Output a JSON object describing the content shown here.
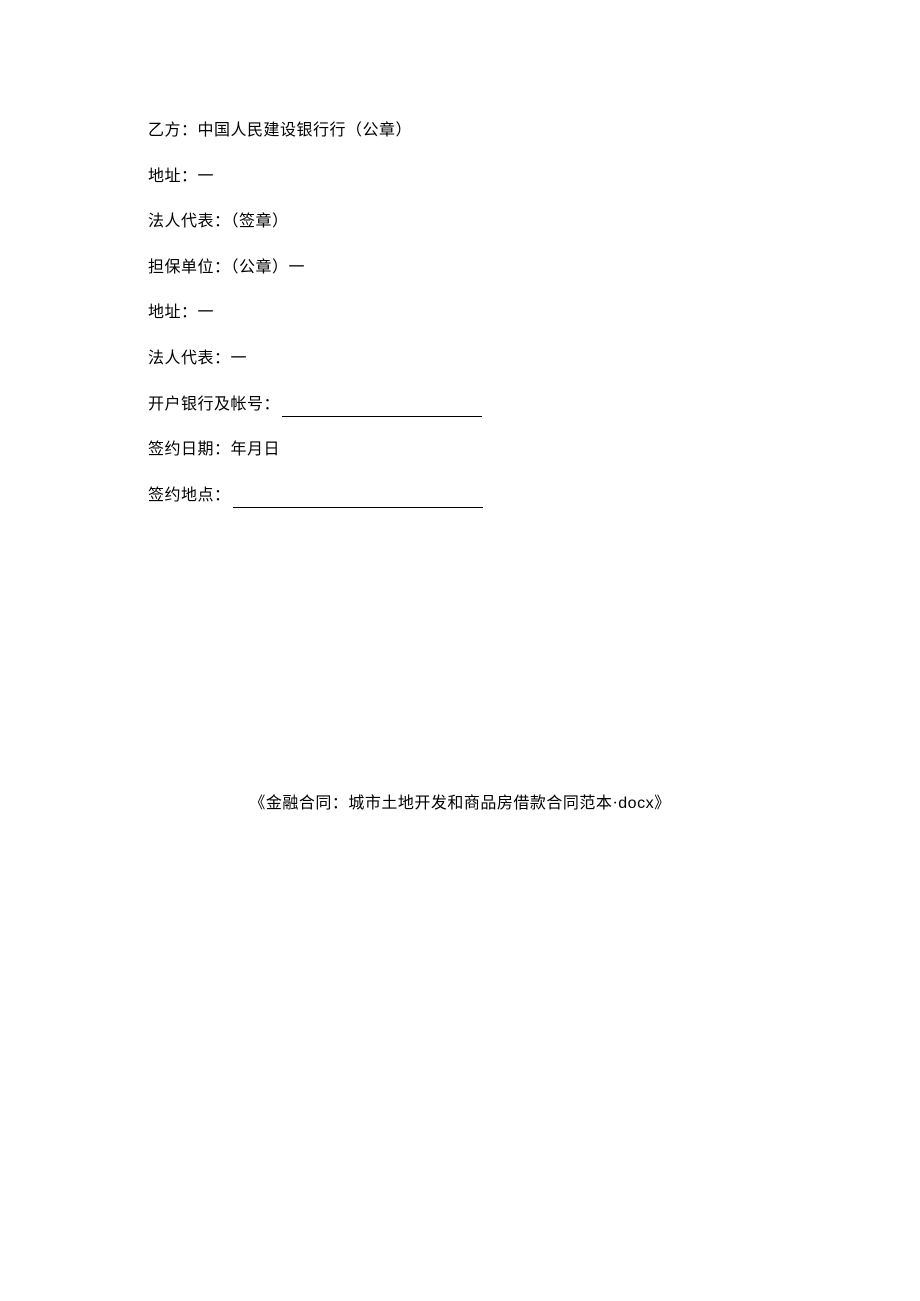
{
  "lines": {
    "party_b": "乙方：中国人民建设银行行（公章）",
    "address1": "地址：一",
    "legal_rep1": "法人代表：（签章）",
    "guarantor": "担保单位：（公章）一",
    "address2": "地址：一",
    "legal_rep2": "法人代表：一",
    "bank_account_label": "开户银行及帐号：",
    "signing_date": "签约日期：年月日",
    "signing_place_label": "签约地点："
  },
  "footer": {
    "prefix": "《金融合同：城市土地开发和商品房借款合同范本",
    "dot": "·",
    "ext": "docx",
    "suffix": "》"
  }
}
